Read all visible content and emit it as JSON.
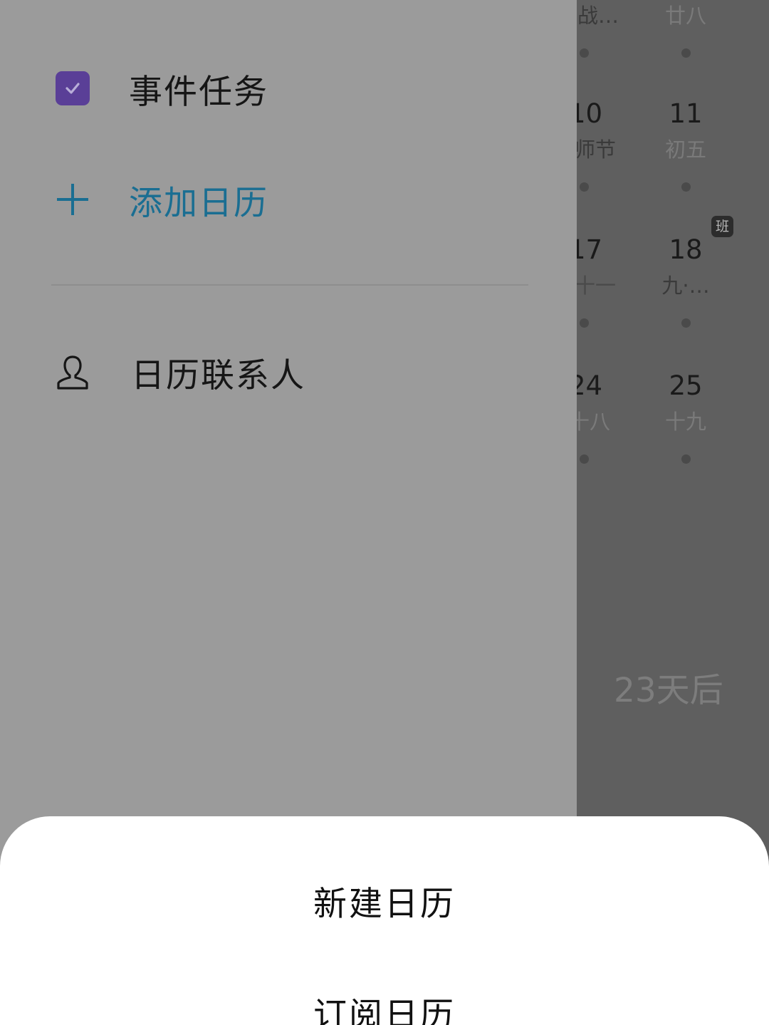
{
  "calendar_bg": {
    "top_row": [
      {
        "lunar": "战…"
      },
      {
        "lunar": "廿八"
      }
    ],
    "rows": [
      {
        "cells": [
          {
            "day": "10",
            "lunar": "师节"
          },
          {
            "day": "11",
            "lunar": "初五"
          }
        ]
      },
      {
        "cells": [
          {
            "day": "17",
            "lunar": "十一"
          },
          {
            "day": "18",
            "lunar": "九·…"
          }
        ]
      },
      {
        "cells": [
          {
            "day": "24",
            "lunar": "十八"
          },
          {
            "day": "25",
            "lunar": "十九"
          }
        ]
      }
    ],
    "work_badge": "班",
    "countdown": "23天后"
  },
  "drawer": {
    "items": [
      {
        "label": "事件任务",
        "icon": "checkbox-checked-icon",
        "checked": true,
        "accent_color": "#5a3f97"
      },
      {
        "label": "添加日历",
        "icon": "plus-icon",
        "accent_color": "#1a6e92"
      },
      {
        "label": "日历联系人",
        "icon": "person-icon"
      }
    ]
  },
  "sheet": {
    "options": [
      {
        "label": "新建日历"
      },
      {
        "label": "订阅日历"
      }
    ]
  }
}
